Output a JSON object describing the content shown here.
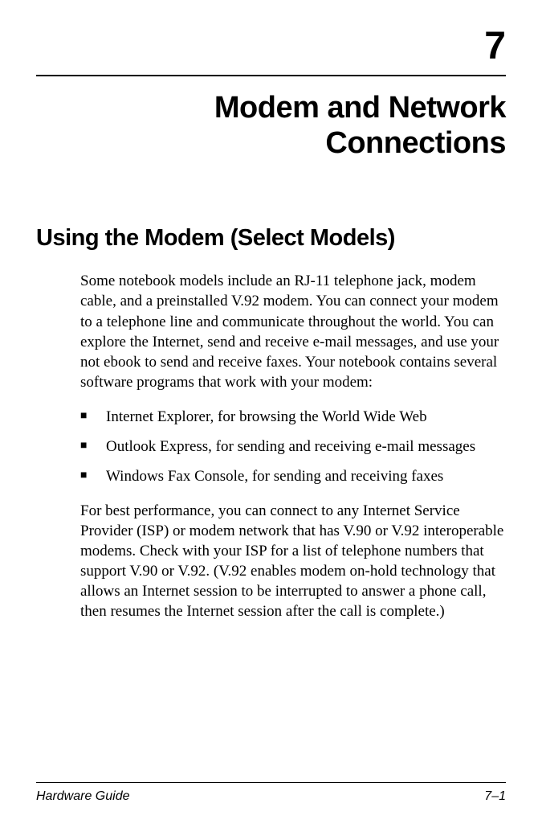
{
  "chapter": {
    "number": "7",
    "title_line1": "Modem and Network",
    "title_line2": "Connections"
  },
  "section": {
    "heading": "Using the Modem (Select Models)",
    "para1": "Some notebook models include an RJ-11 telephone jack, modem cable, and a preinstalled V.92 modem. You can connect your modem to a telephone line and communicate throughout the world. You can explore the Internet, send and receive e-mail messages, and use your not ebook to send and receive faxes. Your notebook contains several software programs that work with your modem:",
    "bullets": [
      "Internet Explorer, for browsing the World Wide Web",
      "Outlook Express, for sending and receiving e-mail messages",
      "Windows Fax Console, for sending and receiving faxes"
    ],
    "para2": "For best performance, you can connect to any Internet Service Provider (ISP) or modem network that has V.90 or V.92 interoperable modems. Check with your ISP for a list of telephone numbers that support V.90 or V.92. (V.92 enables modem on-hold technology that allows an Internet session to be interrupted to answer a phone call, then resumes the Internet session after the call is complete.)"
  },
  "footer": {
    "left": "Hardware Guide",
    "right": "7–1"
  }
}
